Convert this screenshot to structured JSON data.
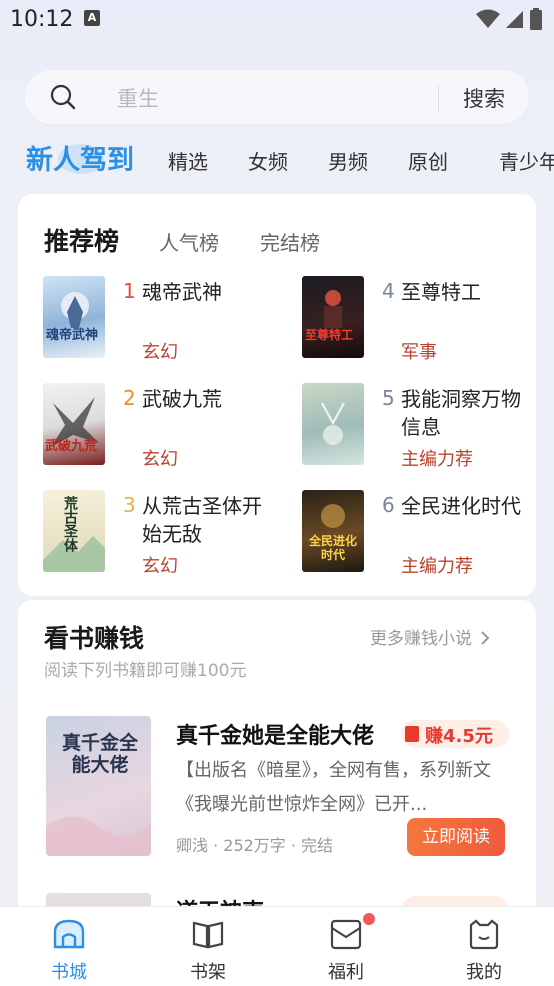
{
  "status_bar": {
    "time": "10:12",
    "notification_letter": "A"
  },
  "search": {
    "placeholder": "重生",
    "button": "搜索"
  },
  "tabs": {
    "active": "新人驾到",
    "items": [
      "精选",
      "女频",
      "男频",
      "原创",
      "青少年"
    ]
  },
  "ranking": {
    "tabs": [
      "推荐榜",
      "人气榜",
      "完结榜"
    ],
    "books": [
      {
        "rank": "1",
        "title": "魂帝武神",
        "tag": "玄幻",
        "cover_text": "魂帝武神"
      },
      {
        "rank": "2",
        "title": "武破九荒",
        "tag": "玄幻",
        "cover_text": "武破九荒"
      },
      {
        "rank": "3",
        "title": "从荒古圣体开始无敌",
        "tag": "玄幻",
        "cover_text": "荒古圣体"
      },
      {
        "rank": "4",
        "title": "至尊特工",
        "tag": "军事",
        "cover_text": "至尊特工"
      },
      {
        "rank": "5",
        "title": "我能洞察万物信息",
        "tag": "主编力荐",
        "cover_text": ""
      },
      {
        "rank": "6",
        "title": "全民进化时代",
        "tag": "主编力荐",
        "cover_text": "全民进化时代"
      }
    ],
    "rank_colors": {
      "1": "#e84c3d",
      "2": "#f08a2c",
      "3": "#e8b04a",
      "other": "#7a8596"
    }
  },
  "earn": {
    "title": "看书赚钱",
    "more": "更多赚钱小说",
    "subtitle": "阅读下列书籍即可赚100元",
    "featured": {
      "title": "真千金她是全能大佬",
      "reward": "赚4.5元",
      "description": "【出版名《暗星》，全网有售，系列新文《我曝光前世惊炸全网》已开...",
      "meta": "卿浅 · 252万字 · 完结",
      "button": "立即阅读",
      "cover_text": "真千金全能大佬"
    },
    "next": {
      "title": "道天神吏"
    }
  },
  "bottom_nav": [
    {
      "label": "书城",
      "active": true
    },
    {
      "label": "书架",
      "active": false
    },
    {
      "label": "福利",
      "active": false,
      "dot": true
    },
    {
      "label": "我的",
      "active": false
    }
  ],
  "colors": {
    "accent": "#2b8fe6",
    "reward": "#e8392d",
    "button": "#f06a3c"
  }
}
